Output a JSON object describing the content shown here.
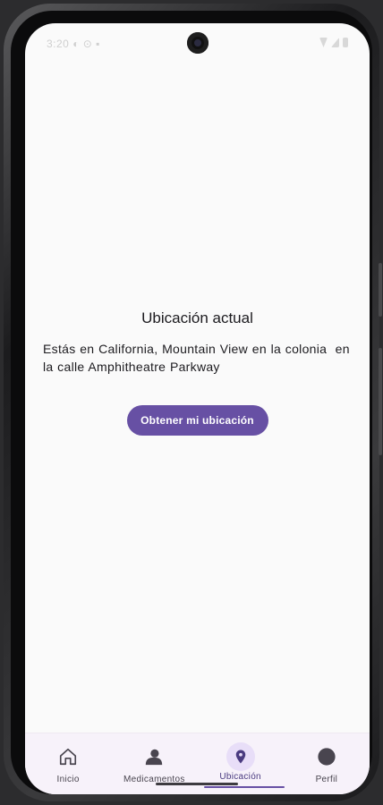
{
  "status_bar": {
    "time": "3:20 ◐ ⊙ ▪"
  },
  "main": {
    "title": "Ubicación actual",
    "location_text": "Estás en California, Mountain View en la colonia  en la calle Amphitheatre Parkway",
    "button_label": "Obtener mi ubicación"
  },
  "bottom_nav": {
    "items": [
      {
        "label": "Inicio",
        "icon": "home-icon",
        "active": false
      },
      {
        "label": "Medicamentos",
        "icon": "person-icon",
        "active": false
      },
      {
        "label": "Ubicación",
        "icon": "location-pin-icon",
        "active": true
      },
      {
        "label": "Perfil",
        "icon": "circle-icon",
        "active": false
      }
    ]
  },
  "colors": {
    "primary": "#6750a4",
    "background": "#fafafa",
    "nav_background": "#f7f2fa",
    "active_indicator": "#e8def8"
  }
}
